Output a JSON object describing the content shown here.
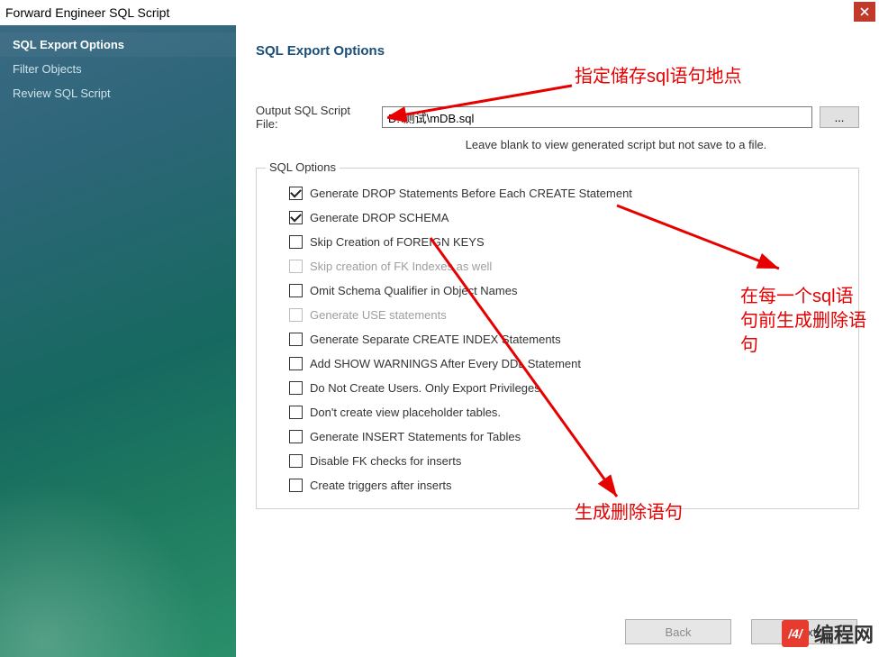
{
  "window": {
    "title": "Forward Engineer SQL Script"
  },
  "sidebar": {
    "items": [
      {
        "label": "SQL Export Options",
        "active": true
      },
      {
        "label": "Filter Objects",
        "active": false
      },
      {
        "label": "Review SQL Script",
        "active": false
      }
    ]
  },
  "main": {
    "heading": "SQL Export Options",
    "file_label": "Output SQL Script File:",
    "file_value": "D:\\测试\\mDB.sql",
    "browse_label": "...",
    "hint": "Leave blank to view generated script but not save to a file.",
    "group_label": "SQL Options",
    "options": [
      {
        "label": "Generate DROP Statements Before Each CREATE Statement",
        "checked": true,
        "disabled": false
      },
      {
        "label": "Generate DROP SCHEMA",
        "checked": true,
        "disabled": false
      },
      {
        "label": "Skip Creation of FOREIGN KEYS",
        "checked": false,
        "disabled": false
      },
      {
        "label": "Skip creation of FK Indexes as well",
        "checked": false,
        "disabled": true
      },
      {
        "label": "Omit Schema Qualifier in Object Names",
        "checked": false,
        "disabled": false
      },
      {
        "label": "Generate USE statements",
        "checked": false,
        "disabled": true
      },
      {
        "label": "Generate Separate CREATE INDEX Statements",
        "checked": false,
        "disabled": false
      },
      {
        "label": "Add SHOW WARNINGS After Every DDL Statement",
        "checked": false,
        "disabled": false
      },
      {
        "label": "Do Not Create Users. Only Export Privileges",
        "checked": false,
        "disabled": false
      },
      {
        "label": "Don't create view placeholder tables.",
        "checked": false,
        "disabled": false
      },
      {
        "label": "Generate INSERT Statements for Tables",
        "checked": false,
        "disabled": false
      },
      {
        "label": "Disable FK checks for inserts",
        "checked": false,
        "disabled": false
      },
      {
        "label": "Create triggers after inserts",
        "checked": false,
        "disabled": false
      }
    ]
  },
  "footer": {
    "back": "Back",
    "next": "Next"
  },
  "annotations": {
    "a1": "指定储存sql语句地点",
    "a2": "在每一个sql语句前生成删除语句",
    "a3": "生成删除语句"
  },
  "watermark": {
    "badge": "/4/",
    "text": "编程网"
  }
}
